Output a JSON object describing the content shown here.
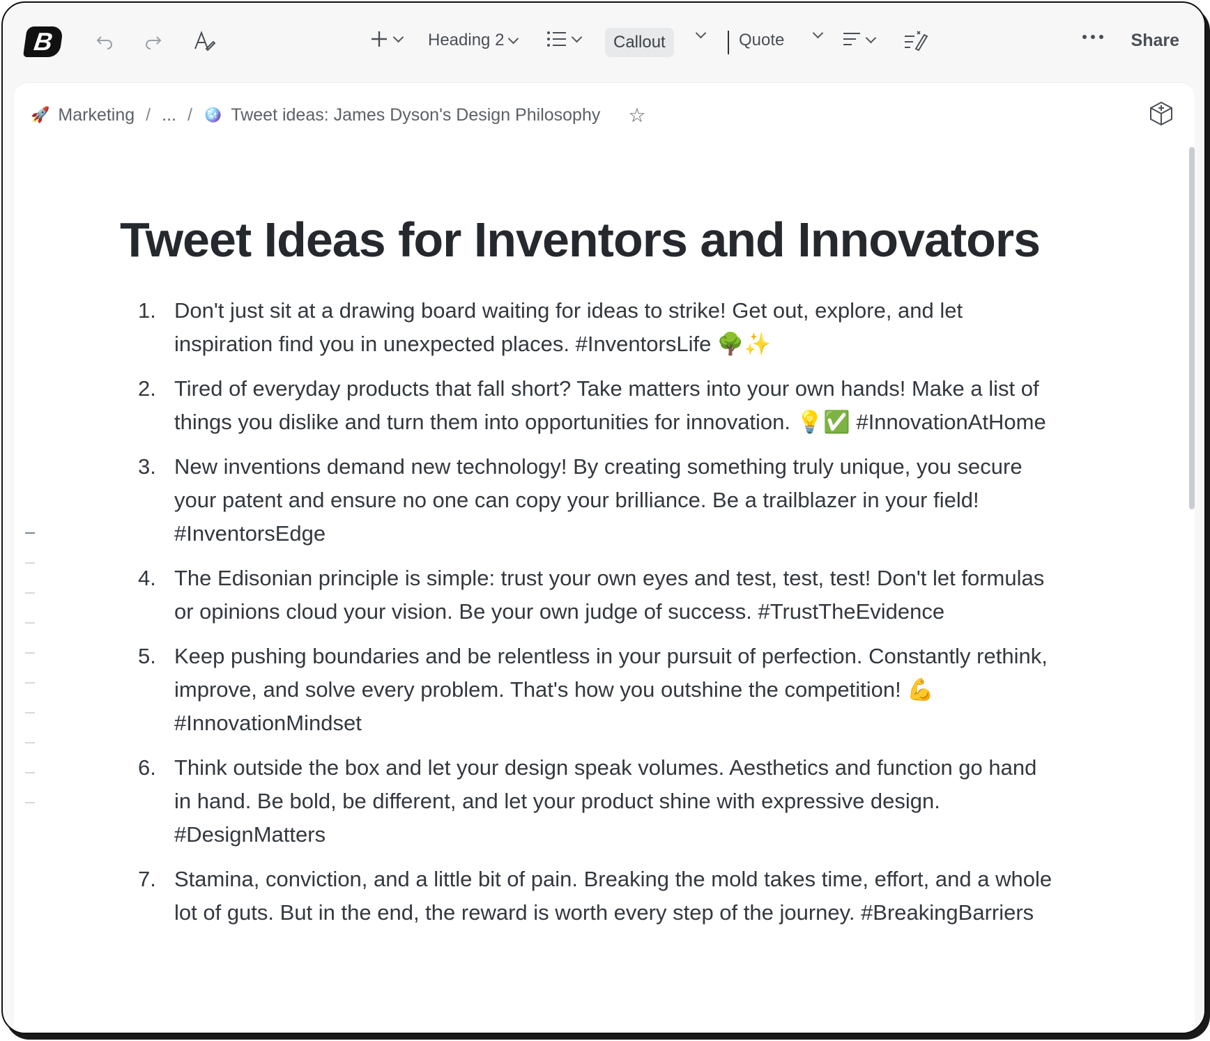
{
  "toolbar": {
    "logo_letter": "B",
    "undo_icon": "undo-icon",
    "redo_icon": "redo-icon",
    "format_icon": "text-format-icon",
    "insert_icon": "plus-icon",
    "heading_select": "Heading 2",
    "list_icon": "bulleted-list-icon",
    "callout_label": "Callout",
    "quote_label": "Quote",
    "align_icon": "align-icon",
    "clear_format_icon": "clear-format-icon",
    "more_icon": "more-dots-icon",
    "share_label": "Share"
  },
  "breadcrumb": {
    "workspace_emoji": "🚀",
    "workspace": "Marketing",
    "separator": "/",
    "ellipsis": "...",
    "page_emoji": "🪩",
    "page": "Tweet ideas: James Dyson's Design Philosophy"
  },
  "document": {
    "title": "Tweet Ideas for Inventors and Innovators",
    "items": [
      {
        "num": "1.",
        "text": "Don't just sit at a drawing board waiting for ideas to strike! Get out, explore, and let inspiration find you in unexpected places. #InventorsLife 🌳✨"
      },
      {
        "num": "2.",
        "text": "Tired of everyday products that fall short? Take matters into your own hands! Make a list of things you dislike and turn them into opportunities for innovation. 💡✅ #InnovationAtHome"
      },
      {
        "num": "3.",
        "text": "New inventions demand new technology! By creating something truly unique, you secure your patent and ensure no one can copy your brilliance. Be a trailblazer in your field! #InventorsEdge"
      },
      {
        "num": "4.",
        "text": "The Edisonian principle is simple: trust your own eyes and test, test, test! Don't let formulas or opinions cloud your vision. Be your own judge of success. #TrustTheEvidence"
      },
      {
        "num": "5.",
        "text": "Keep pushing boundaries and be relentless in your pursuit of perfection. Constantly rethink, improve, and solve every problem. That's how you outshine the competition! 💪#InnovationMindset"
      },
      {
        "num": "6.",
        "text": "Think outside the box and let your design speak volumes. Aesthetics and function go hand in hand. Be bold, be different, and let your product shine with expressive design. #DesignMatters"
      },
      {
        "num": "7.",
        "text": "Stamina, conviction, and a little bit of pain. Breaking the mold takes time, effort, and a whole lot of guts. But in the end, the reward is worth every step of the journey. #BreakingBarriers"
      }
    ]
  }
}
